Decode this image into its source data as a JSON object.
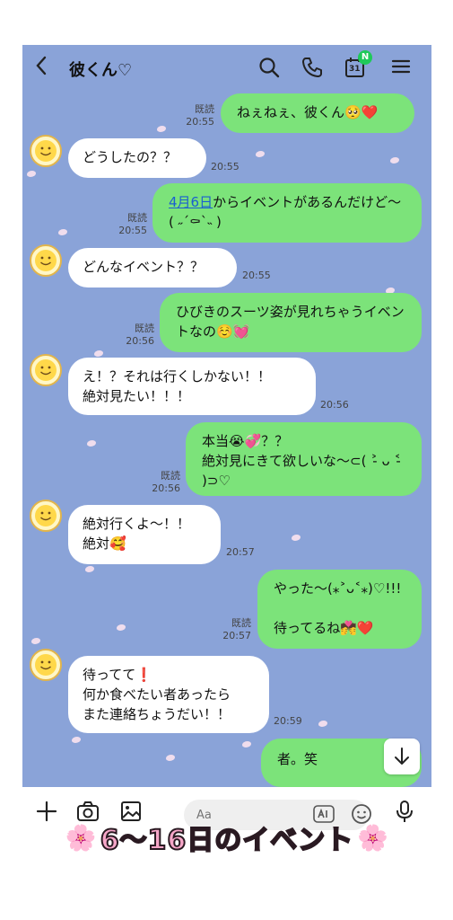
{
  "header": {
    "back_icon": "chevron-left-icon",
    "title": "彼くん♡",
    "calendar_day": "31",
    "calendar_badge": "N"
  },
  "messages": [
    {
      "side": "mine",
      "text": "ねぇねぇ、彼くん🥺❤️",
      "read": "既読",
      "time": "20:55"
    },
    {
      "side": "theirs",
      "text": "どうしたの？？",
      "time": "20:55"
    },
    {
      "side": "mine",
      "link": "4月6日",
      "text": "からイベントがあるんだけど〜( ˶´⚰︎`˵ )",
      "read": "既読",
      "time": "20:55"
    },
    {
      "side": "theirs",
      "text": "どんなイベント？？",
      "time": "20:55"
    },
    {
      "side": "mine",
      "text": "ひびきのスーツ姿が見れちゃうイベントなの☺️💓",
      "read": "既読",
      "time": "20:56"
    },
    {
      "side": "theirs",
      "text": "え！？それは行くしかない！！\n絶対見たい！！！",
      "time": "20:56"
    },
    {
      "side": "mine",
      "text": "本当😭💞？？\n絶対見にきて欲しいな〜⊂( ˃̵ ᴗ ˂̵ )⊃♡",
      "read": "既読",
      "time": "20:56"
    },
    {
      "side": "theirs",
      "text": "絶対行くよ〜！！\n絶対🥰",
      "time": "20:57"
    },
    {
      "side": "mine",
      "text": "やった〜(⁎˃ᴗ˂⁎)♡!!!\n\n待ってるね💏❤️",
      "read": "既読",
      "time": "20:57"
    },
    {
      "side": "theirs",
      "text": "待ってて❗️\n何か食べたい者あったら\nまた連絡ちょうだい！！",
      "time": "20:59"
    },
    {
      "side": "mine",
      "text": "者。笑"
    }
  ],
  "input": {
    "placeholder": "Aa"
  },
  "banner": {
    "text": "6〜16日のイベント",
    "flower": "🌸"
  }
}
